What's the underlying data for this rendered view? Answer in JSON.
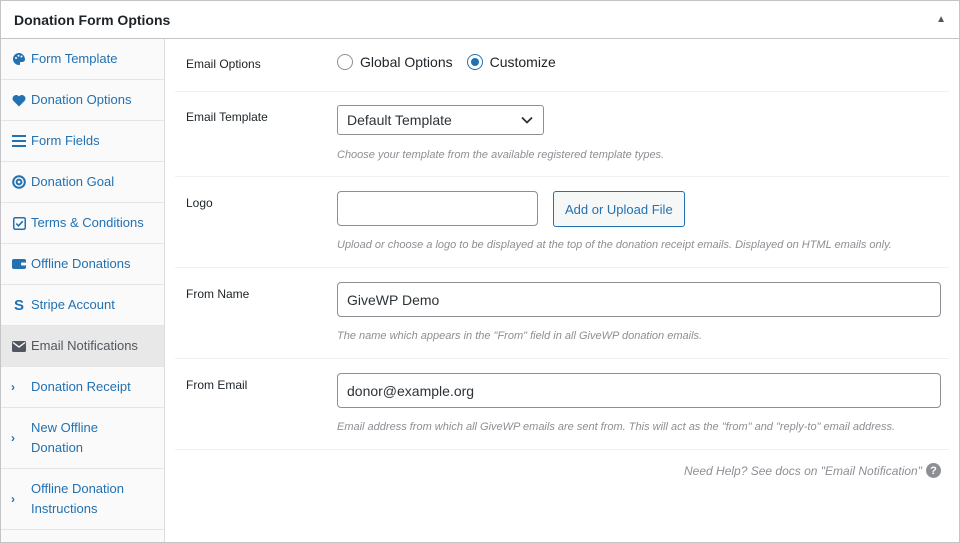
{
  "panel": {
    "title": "Donation Form Options"
  },
  "sidebar": {
    "items": [
      {
        "label": "Form Template",
        "icon": "palette-icon"
      },
      {
        "label": "Donation Options",
        "icon": "heart-icon"
      },
      {
        "label": "Form Fields",
        "icon": "list-icon"
      },
      {
        "label": "Donation Goal",
        "icon": "target-icon"
      },
      {
        "label": "Terms & Conditions",
        "icon": "checkbox-icon"
      },
      {
        "label": "Offline Donations",
        "icon": "wallet-icon"
      },
      {
        "label": "Stripe Account",
        "icon": "stripe-icon"
      },
      {
        "label": "Email Notifications",
        "icon": "envelope-icon",
        "active": true
      },
      {
        "label": "Donation Receipt",
        "icon": "chevron-right-icon"
      },
      {
        "label": "New Offline Donation",
        "icon": "chevron-right-icon"
      },
      {
        "label": "Offline Donation Instructions",
        "icon": "chevron-right-icon"
      }
    ]
  },
  "fields": {
    "email_options": {
      "label": "Email Options",
      "options": [
        "Global Options",
        "Customize"
      ],
      "selected": "Customize"
    },
    "email_template": {
      "label": "Email Template",
      "value": "Default Template",
      "description": "Choose your template from the available registered template types."
    },
    "logo": {
      "label": "Logo",
      "value": "",
      "button": "Add or Upload File",
      "description": "Upload or choose a logo to be displayed at the top of the donation receipt emails. Displayed on HTML emails only."
    },
    "from_name": {
      "label": "From Name",
      "value": "GiveWP Demo",
      "description": "The name which appears in the \"From\" field in all GiveWP donation emails."
    },
    "from_email": {
      "label": "From Email",
      "value": "donor@example.org",
      "description": "Email address from which all GiveWP emails are sent from. This will act as the \"from\" and \"reply-to\" email address."
    }
  },
  "help": {
    "text": "Need Help? See docs on \"Email Notification\"",
    "icon_glyph": "?"
  },
  "colors": {
    "accent": "#2271b1",
    "muted": "#8c8f94",
    "active_bg": "#e8e8e8"
  }
}
